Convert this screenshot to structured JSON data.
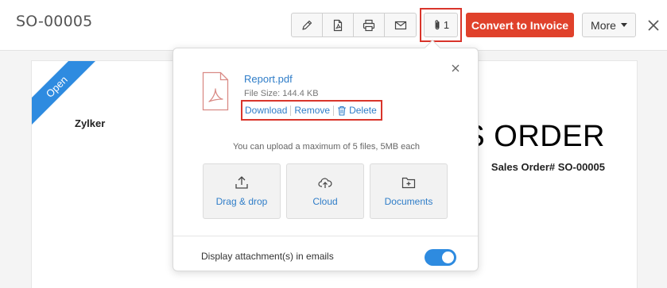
{
  "header": {
    "doc_id": "SO-00005",
    "attachment_count": "1",
    "convert_label": "Convert to Invoice",
    "more_label": "More"
  },
  "document": {
    "status": "Open",
    "org_name": "Zylker",
    "title_visible": "ES ORDER",
    "number": "Sales Order# SO-00005"
  },
  "attachments_popover": {
    "file": {
      "name": "Report.pdf",
      "size": "File Size: 144.4 KB",
      "download_label": "Download",
      "remove_label": "Remove",
      "delete_label": "Delete"
    },
    "upload_note": "You can upload a maximum of 5 files, 5MB each",
    "upload_options": [
      {
        "label": "Drag & drop",
        "icon": "upload-icon"
      },
      {
        "label": "Cloud",
        "icon": "cloud-upload-icon"
      },
      {
        "label": "Documents",
        "icon": "folder-add-icon"
      }
    ],
    "footer_label": "Display attachment(s) in emails",
    "toggle_on": true
  },
  "colors": {
    "accent": "#e0412b",
    "link": "#2f7dc8",
    "ribbon": "#2e8be0",
    "highlight": "#d9352b",
    "toggle": "#2e8be0"
  }
}
